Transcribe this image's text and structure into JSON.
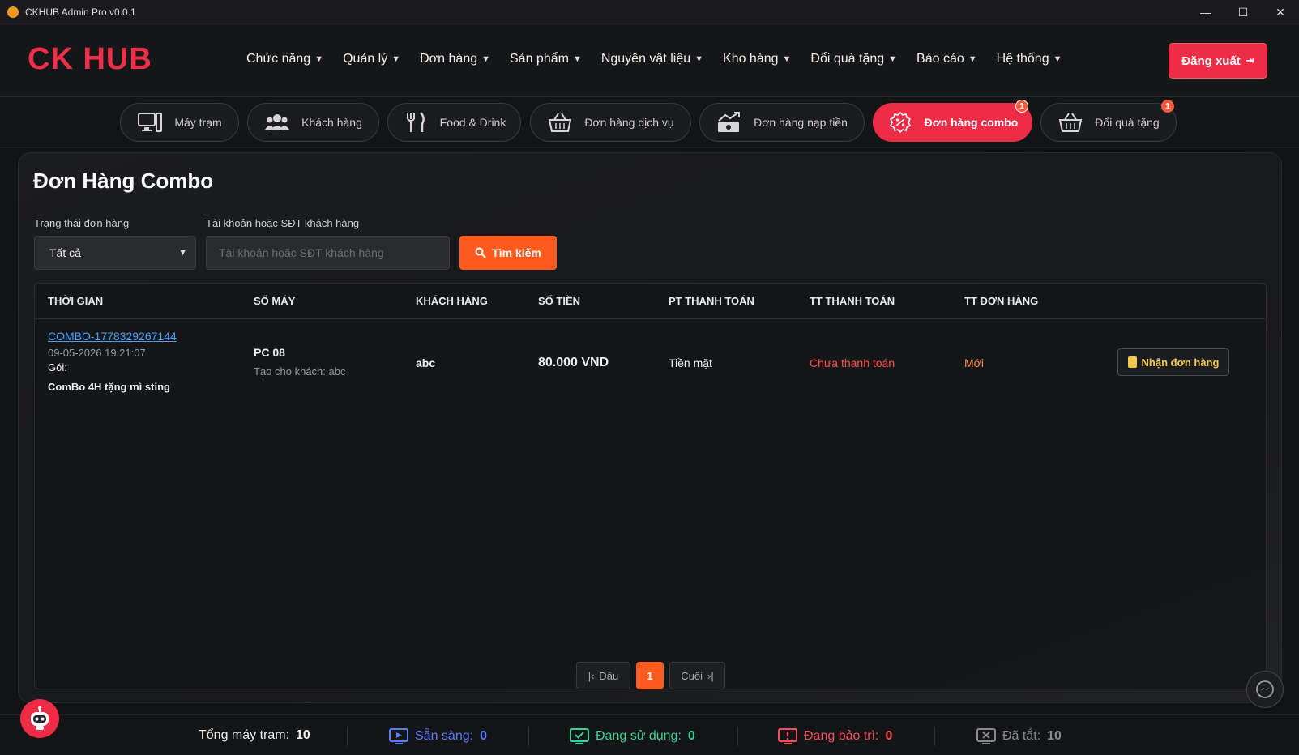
{
  "window": {
    "title": "CKHUB Admin Pro v0.0.1",
    "min": "—",
    "max": "☐",
    "close": "✕"
  },
  "header": {
    "logo": "CK HUB",
    "nav": [
      "Chức năng",
      "Quản lý",
      "Đơn hàng",
      "Sản phẩm",
      "Nguyên vật liệu",
      "Kho hàng",
      "Đổi quà tặng",
      "Báo cáo",
      "Hệ thống"
    ],
    "logout_label": "Đăng xuất"
  },
  "tabs": [
    {
      "label": "Máy trạm",
      "icon": "computer-icon"
    },
    {
      "label": "Khách hàng",
      "icon": "users-icon"
    },
    {
      "label": "Food & Drink",
      "icon": "utensils-icon"
    },
    {
      "label": "Đơn hàng dịch vụ",
      "icon": "basket-icon"
    },
    {
      "label": "Đơn hàng nạp tiền",
      "icon": "money-chart-icon"
    },
    {
      "label": "Đơn hàng combo",
      "icon": "discount-icon",
      "active": true,
      "badge": "1"
    },
    {
      "label": "Đổi quà tặng",
      "icon": "basket-icon",
      "badge": "1"
    }
  ],
  "page": {
    "title": "Đơn Hàng Combo",
    "status_filter_label": "Trạng thái đơn hàng",
    "status_filter_value": "Tất cả",
    "customer_filter_label": "Tài khoản hoặc SĐT khách hàng",
    "customer_filter_placeholder": "Tài khoản hoặc SĐT khách hàng",
    "search_label": "Tìm kiếm"
  },
  "table": {
    "headers": [
      "THỜI GIAN",
      "SỐ MÁY",
      "KHÁCH HÀNG",
      "SỐ TIỀN",
      "PT THANH TOÁN",
      "TT THANH TOÁN",
      "TT ĐƠN HÀNG"
    ],
    "rows": [
      {
        "order_code": "COMBO-1778329267144",
        "datetime": "09-05-2026 19:21:07",
        "package_label": "Gói:",
        "package_name": "ComBo 4H tặng mì sting",
        "machine": "PC 08",
        "created_for": "Tạo cho khách: abc",
        "customer": "abc",
        "amount": "80.000 VND",
        "payment_method": "Tiền mặt",
        "payment_status": "Chưa thanh toán",
        "order_status": "Mới",
        "action_label": "Nhận đơn hàng"
      }
    ]
  },
  "pagination": {
    "first": "Đầu",
    "current": "1",
    "last": "Cuối"
  },
  "statusbar": {
    "total_label": "Tổng máy trạm:",
    "total_value": "10",
    "ready_label": "Sẵn sàng:",
    "ready_value": "0",
    "in_use_label": "Đang sử dụng:",
    "in_use_value": "0",
    "maintenance_label": "Đang bảo trì:",
    "maintenance_value": "0",
    "off_label": "Đã tắt:",
    "off_value": "10"
  },
  "colors": {
    "accent_red": "#ee2c46",
    "accent_orange": "#ff5a1f",
    "link_blue": "#4a9dff",
    "unpaid_red": "#ff4d4d",
    "new_orange": "#ff8a3d",
    "ready_blue": "#5b7cff",
    "in_use_green": "#34d399",
    "maintenance_red": "#ff4d5a",
    "off_gray": "#8a8a8e"
  }
}
